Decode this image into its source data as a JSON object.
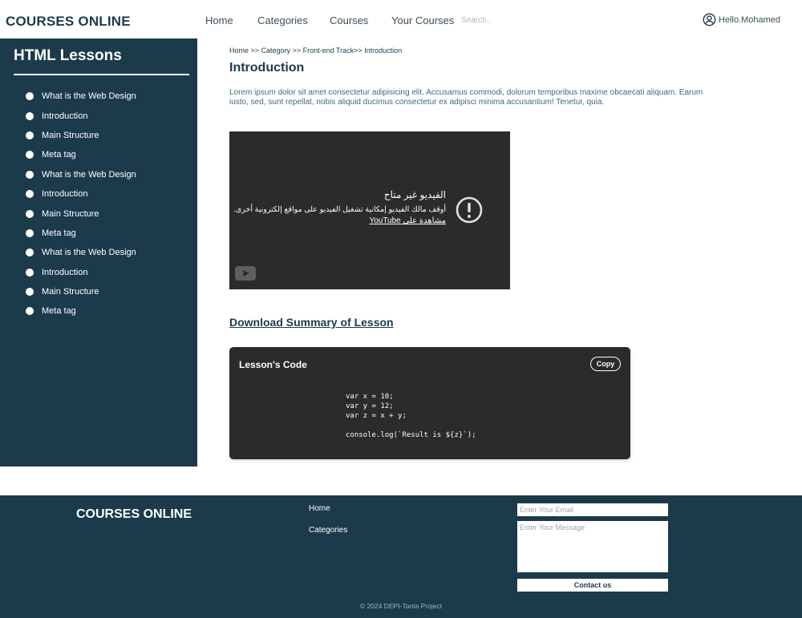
{
  "header": {
    "brand": "COURSES ONLINE",
    "nav": [
      "Home",
      "Categories",
      "Courses",
      "Your Courses"
    ],
    "search_placeholder": "Search..",
    "user_greeting": "Hello.Mohamed"
  },
  "sidebar": {
    "title": "HTML Lessons",
    "items": [
      "What is the Web Design",
      "Introduction",
      "Main Structure",
      "Meta tag",
      "What is the Web Design",
      "Introduction",
      "Main Structure",
      "Meta tag",
      "What is the Web Design",
      "Introduction",
      "Main Structure",
      "Meta tag"
    ]
  },
  "main": {
    "breadcrumb": {
      "home": "Home",
      "sep1": " >> ",
      "category": "Category",
      "sep2": " >> ",
      "track": "Front-end Track",
      "sep3": ">> ",
      "current": "Introduction"
    },
    "title": "Introduction",
    "text": "Lorem ipsum dolor sit amet consectetur adipisicing elit. Accusamus commodi, dolorum temporibus maxime obcaecati aliquam. Earum iusto, sed, sunt repellat, nobis aliquid ducimus consectetur ex adipisci minima accusantium! Tenetur, quia.",
    "video": {
      "heading": "الفيديو غير متاح",
      "message": "أوقف مالك الفيديو إمكانية تشغيل الفيديو على مواقع إلكترونية أخرى.",
      "link": "مشاهدة على YouTube"
    },
    "download_label": "Download Summary of Lesson",
    "code_box": {
      "title": "Lesson's Code",
      "copy_label": "Copy",
      "code": "var x = 10;\nvar y = 12;\nvar z = x + y;\n\nconsole.log(`Result is ${z}`);"
    }
  },
  "footer": {
    "brand": "COURSES ONLINE",
    "links": [
      "Home",
      "Categories"
    ],
    "email_placeholder": "Enter Your Email",
    "message_placeholder": "Enter Your Message",
    "contact_label": "Contact us",
    "copyright": "© 2024 DEPI-Tanta Project"
  },
  "colors": {
    "primary": "#1c3b4a",
    "video_bg": "#2b2a2c",
    "text_muted": "#3e6a7e"
  }
}
